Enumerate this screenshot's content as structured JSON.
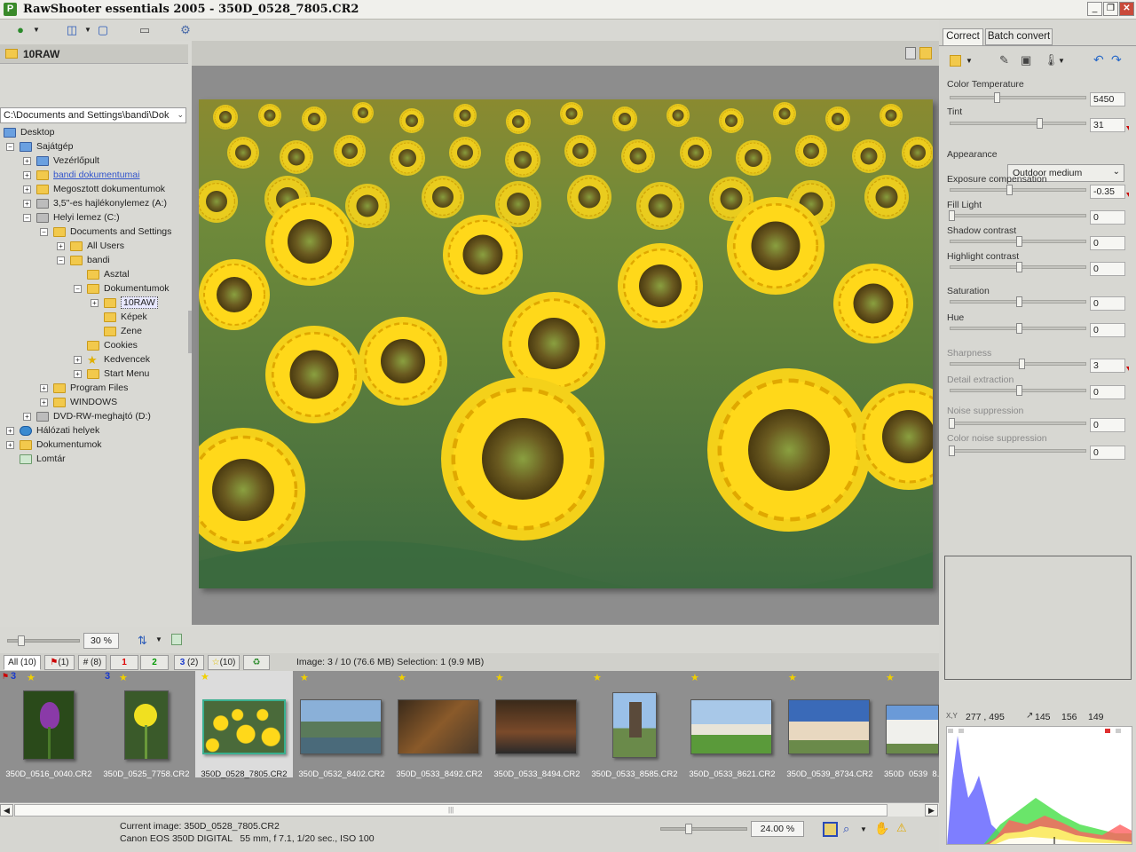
{
  "window": {
    "title": "RawShooter essentials 2005 - 350D_0528_7805.CR2"
  },
  "left": {
    "folder_header": "10RAW",
    "path": "C:\\Documents and Settings\\bandi\\Dok",
    "tree": [
      {
        "label": "Desktop"
      },
      {
        "label": "Sajátgép"
      },
      {
        "label": "Vezérlőpult"
      },
      {
        "label": "bandi dokumentumai"
      },
      {
        "label": "Megosztott dokumentumok"
      },
      {
        "label": "3,5\"-es hajlékonylemez (A:)"
      },
      {
        "label": "Helyi lemez (C:)"
      },
      {
        "label": "Documents and Settings"
      },
      {
        "label": "All Users"
      },
      {
        "label": "bandi"
      },
      {
        "label": "Asztal"
      },
      {
        "label": "Dokumentumok"
      },
      {
        "label": "10RAW"
      },
      {
        "label": "Képek"
      },
      {
        "label": "Zene"
      },
      {
        "label": "Cookies"
      },
      {
        "label": "Kedvencek"
      },
      {
        "label": "Start Menu"
      },
      {
        "label": "Program Files"
      },
      {
        "label": "WINDOWS"
      },
      {
        "label": "DVD-RW-meghajtó (D:)"
      },
      {
        "label": "Hálózati helyek"
      },
      {
        "label": "Dokumentumok"
      },
      {
        "label": "Lomtár"
      }
    ]
  },
  "zoom": {
    "value": "30 %"
  },
  "filters": {
    "all": "All (10)",
    "flag": "(1)",
    "hash": "# (8)",
    "r1": "1",
    "r2": "2",
    "r3": "3",
    "r3c": "(2)",
    "star": "(10)"
  },
  "image_info": "Image: 3 / 10 (76.6 MB) Selection: 1 (9.9 MB)",
  "thumbnails": [
    {
      "name": "350D_0516_0040.CR2",
      "badge": "3"
    },
    {
      "name": "350D_0525_7758.CR2",
      "badge": "3"
    },
    {
      "name": "350D_0528_7805.CR2",
      "badge": ""
    },
    {
      "name": "350D_0532_8402.CR2",
      "badge": ""
    },
    {
      "name": "350D_0533_8492.CR2",
      "badge": ""
    },
    {
      "name": "350D_0533_8494.CR2",
      "badge": ""
    },
    {
      "name": "350D_0533_8585.CR2",
      "badge": ""
    },
    {
      "name": "350D_0533_8621.CR2",
      "badge": ""
    },
    {
      "name": "350D_0539_8734.CR2",
      "badge": ""
    },
    {
      "name": "350D_0539_8...",
      "badge": ""
    }
  ],
  "status": {
    "current": "Current image: 350D_0528_7805.CR2",
    "camera": "Canon EOS 350D DIGITAL   55 mm, f 7.1, 1/20 sec., ISO 100",
    "zoom": "24.00 %"
  },
  "right": {
    "tab_correct": "Correct",
    "tab_batch": "Batch convert",
    "color_temp_label": "Color Temperature",
    "color_temp": "5450",
    "tint_label": "Tint",
    "tint": "31",
    "appearance_label": "Appearance",
    "appearance": "Outdoor medium",
    "exposure_label": "Exposure compensation",
    "exposure": "-0.35",
    "fill_label": "Fill Light",
    "fill": "0",
    "shadow_label": "Shadow contrast",
    "shadow": "0",
    "highlight_label": "Highlight contrast",
    "highlight": "0",
    "saturation_label": "Saturation",
    "saturation": "0",
    "hue_label": "Hue",
    "hue": "0",
    "sharpness_label": "Sharpness",
    "sharpness": "3",
    "detail_label": "Detail extraction",
    "detail": "0",
    "noise_label": "Noise suppression",
    "noise": "0",
    "colornoise_label": "Color noise suppression",
    "colornoise": "0",
    "xy_label": "X,Y",
    "xy": "277 , 495",
    "rgb_r": "145",
    "rgb_g": "156",
    "rgb_b": "149"
  }
}
